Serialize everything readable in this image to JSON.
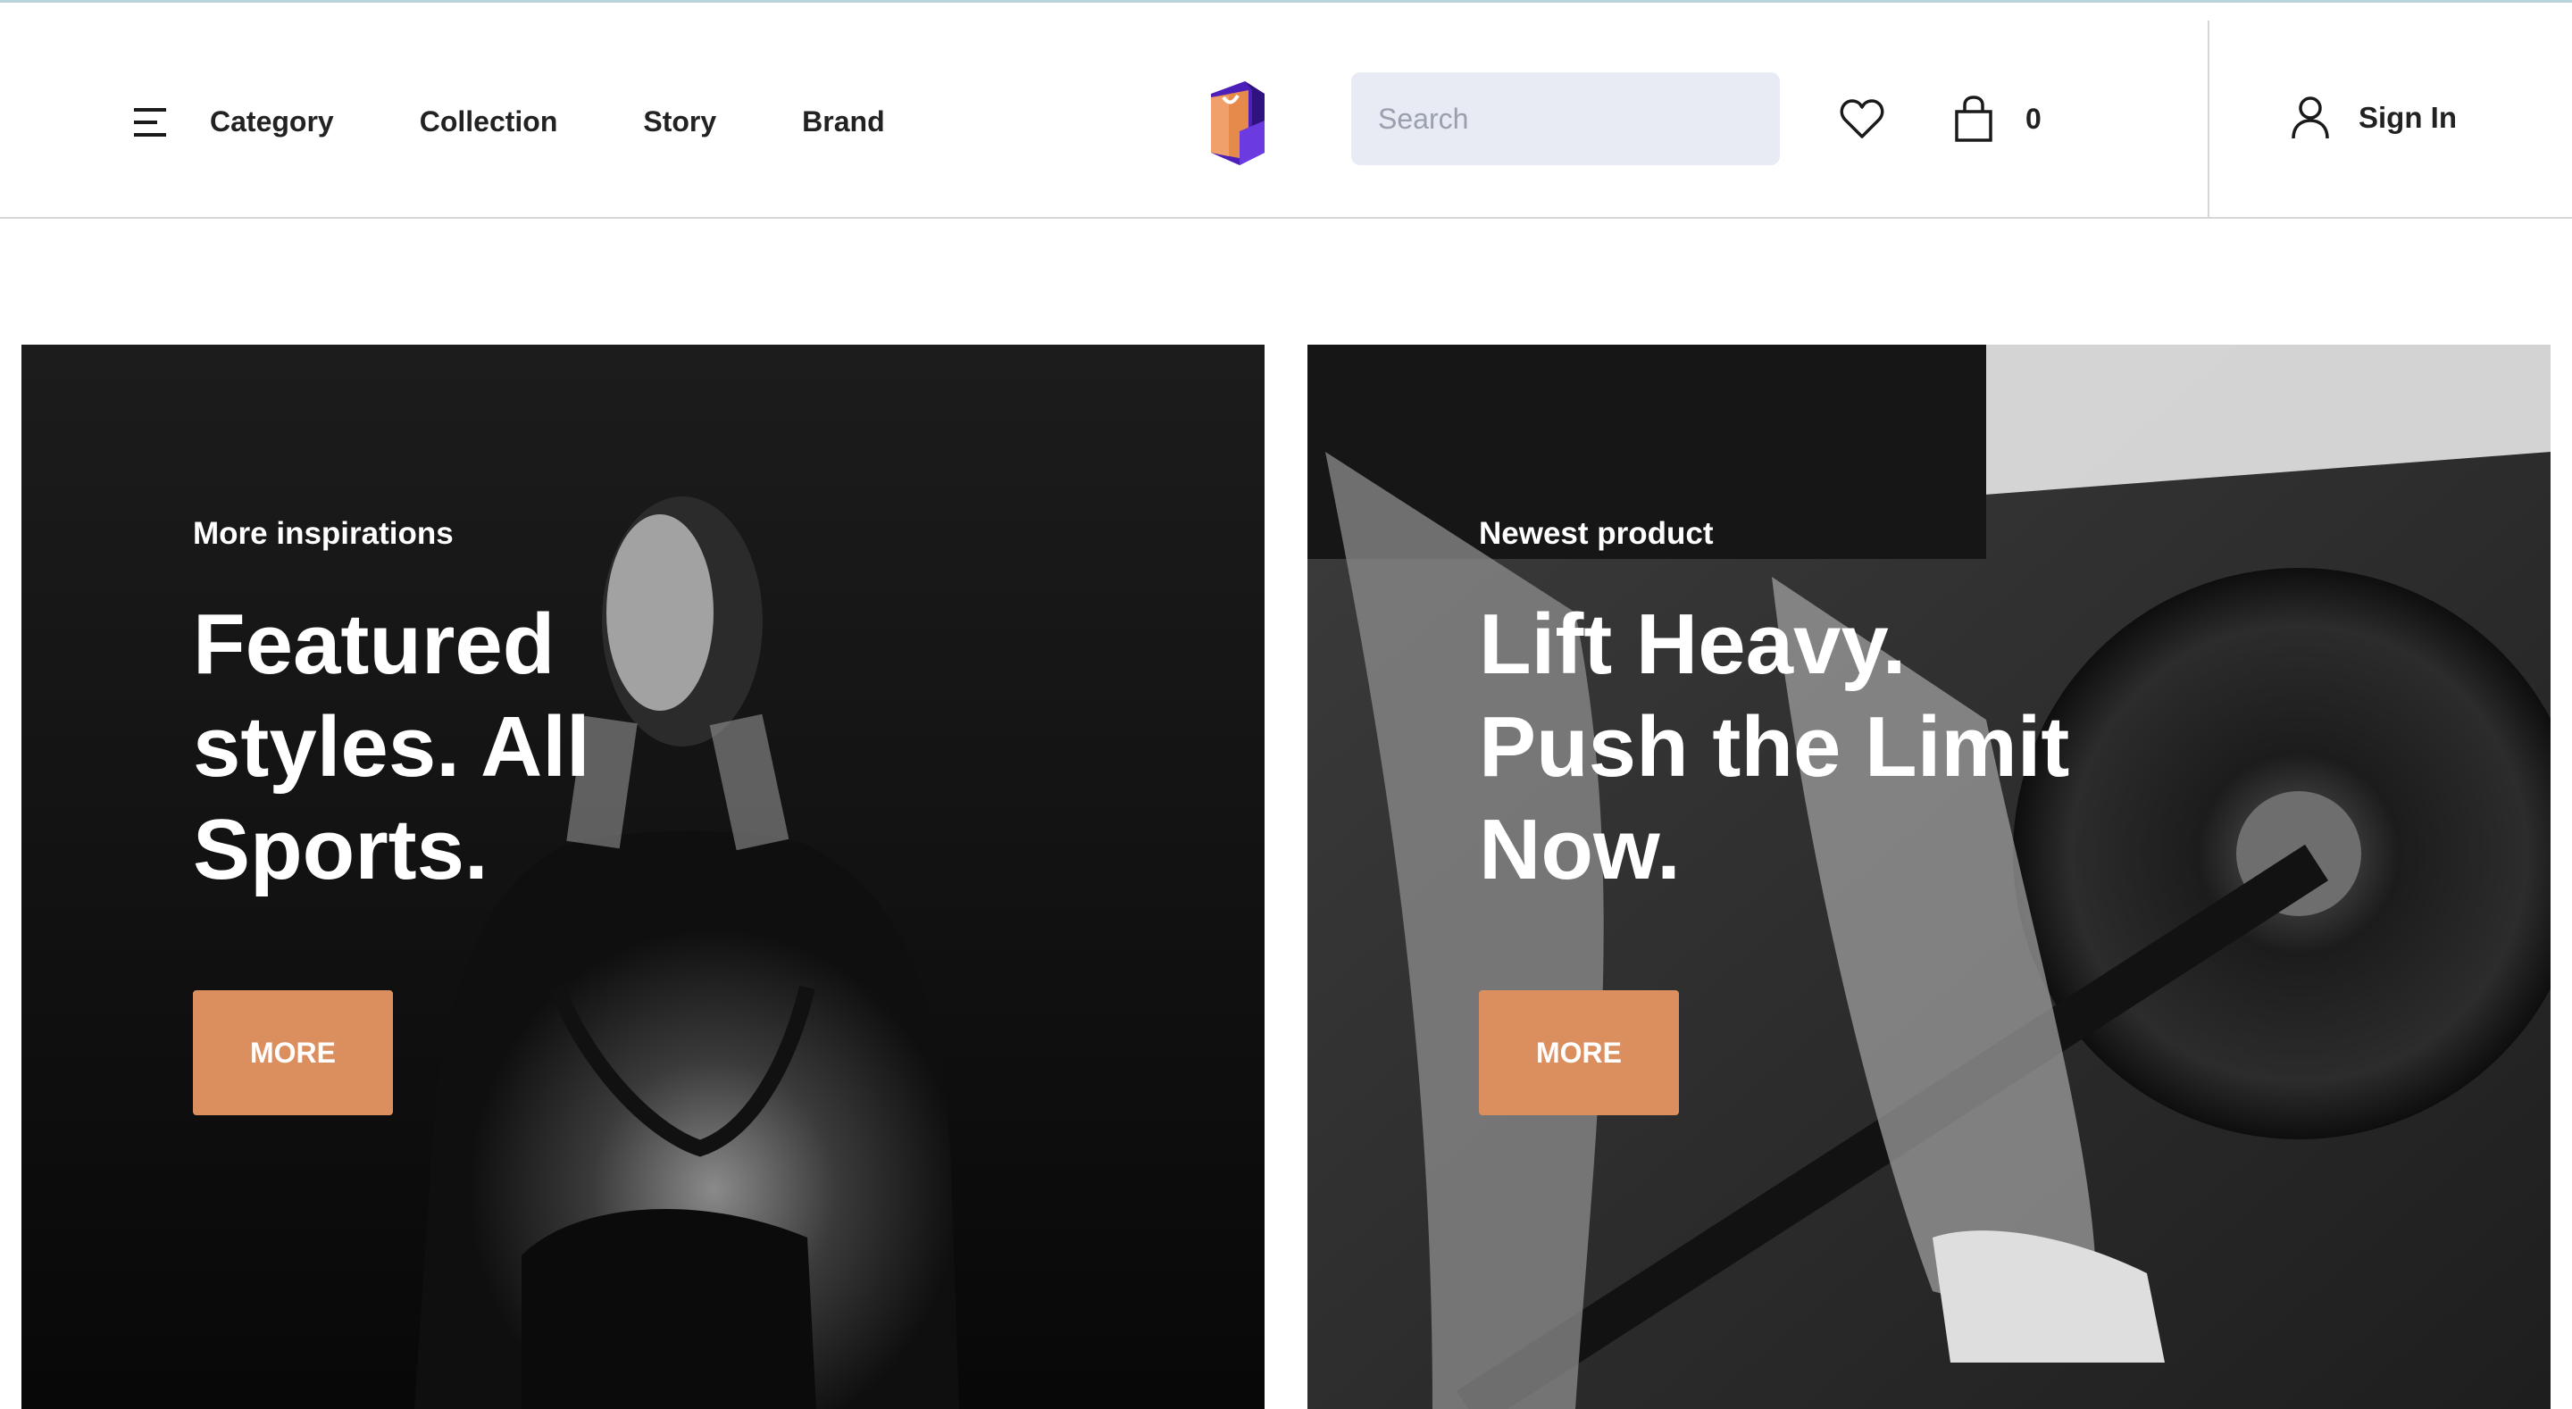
{
  "header": {
    "nav": [
      "Category",
      "Collection",
      "Story",
      "Brand"
    ],
    "search": {
      "placeholder": "Search",
      "value": ""
    },
    "cart_count": "0",
    "signin_label": "Sign In"
  },
  "colors": {
    "accent": "#dc8f5e",
    "search_bg": "#e8eaf4",
    "logo_purple": "#5b2bd6",
    "logo_orange": "#e58a4b"
  },
  "hero": {
    "cards": [
      {
        "eyebrow": "More inspirations",
        "headline_lines": [
          "Featured",
          "styles. All",
          "Sports."
        ],
        "button_label": "MORE"
      },
      {
        "eyebrow": "Newest product",
        "headline_lines": [
          "Lift Heavy.",
          "Push the Limit",
          "Now."
        ],
        "button_label": "MORE"
      }
    ]
  }
}
